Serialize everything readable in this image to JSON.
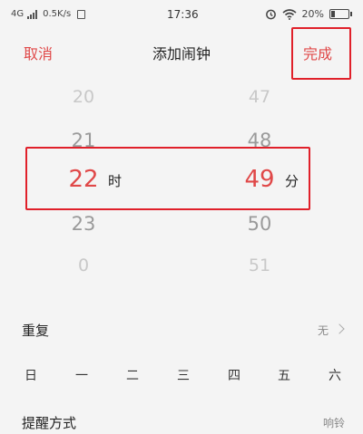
{
  "status_bar": {
    "network": "4G",
    "speed": "0.5K/s",
    "time": "17:36",
    "battery": "20%",
    "battery_level": 0.2,
    "icons": [
      "signal-icon",
      "sim-icon",
      "alarm-clock-icon",
      "wifi-icon",
      "battery-icon"
    ]
  },
  "header": {
    "cancel_label": "取消",
    "title": "添加闹钟",
    "done_label": "完成"
  },
  "picker": {
    "hours": [
      "20",
      "21",
      "22",
      "23",
      "0"
    ],
    "hour_unit": "时",
    "minutes": [
      "47",
      "48",
      "49",
      "50",
      "51"
    ],
    "minute_unit": "分",
    "selected_hour": "22",
    "selected_minute": "49"
  },
  "repeat": {
    "label": "重复",
    "value": "无",
    "weekdays": [
      "日",
      "一",
      "二",
      "三",
      "四",
      "五",
      "六"
    ]
  },
  "alert": {
    "label": "提醒方式",
    "value": "响铃"
  },
  "colors": {
    "accent": "#e04848",
    "highlight_box": "#e0202a",
    "background": "#f4f4f4"
  }
}
